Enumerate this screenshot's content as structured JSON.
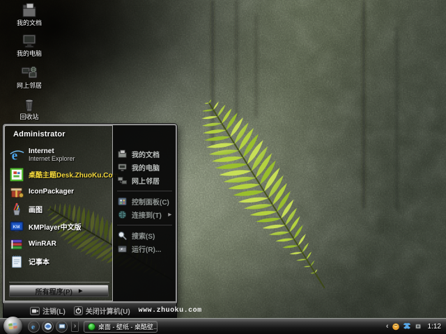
{
  "desktop": {
    "icons": [
      {
        "label": "我的文档"
      },
      {
        "label": "我的电脑"
      },
      {
        "label": "网上邻居"
      },
      {
        "label": "回收站"
      }
    ]
  },
  "start_menu": {
    "user_name": "Administrator",
    "left_items": [
      {
        "label": "Internet",
        "sublabel": "Internet Explorer"
      },
      {
        "label": "桌酷主题Desk.ZhuoKu.Com"
      },
      {
        "label": "IconPackager"
      },
      {
        "label": "画图"
      },
      {
        "label": "KMPlayer中文版"
      },
      {
        "label": "WinRAR"
      },
      {
        "label": "记事本"
      }
    ],
    "places": [
      {
        "label": "我的文档"
      },
      {
        "label": "我的电脑"
      },
      {
        "label": "网上邻居"
      }
    ],
    "settings": [
      {
        "label": "控制面板(C)"
      },
      {
        "label": "连接到(T)"
      }
    ],
    "actions": [
      {
        "label": "搜索(S)"
      },
      {
        "label": "运行(R)..."
      }
    ],
    "all_programs_label": "所有程序(P)",
    "logoff_label": "注销(L)",
    "shutdown_label": "关闭计算机(U)",
    "website": "www.zhuoku.com"
  },
  "taskbar": {
    "task_button_label": "桌面 - 壁纸 - 桌酷壁...",
    "clock": "1:12"
  },
  "glyphs": {
    "all_programs_arrow": "▶",
    "submenu_arrow": "▶",
    "quicklaunch_expand": "›",
    "tray_chevron": "‹"
  },
  "colors": {
    "zhuoku_item_yellow": "#f5d93c",
    "fern_green": "#a9d032",
    "task_icon_green": "#2fae2f"
  }
}
